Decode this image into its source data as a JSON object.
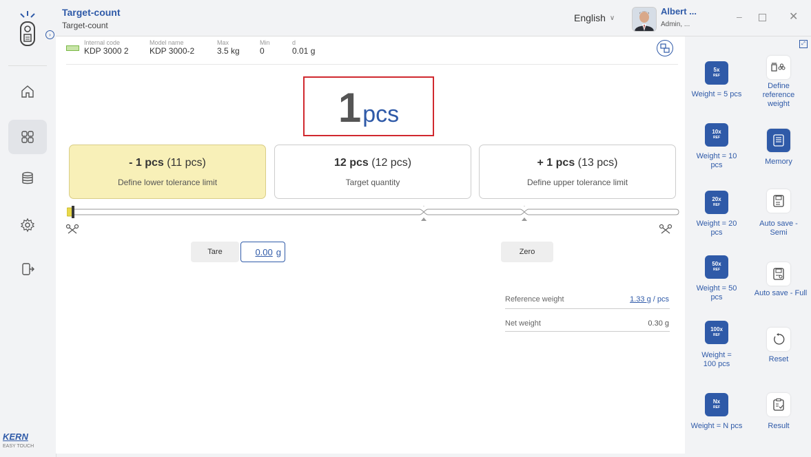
{
  "app": {
    "title": "Target-count",
    "subtitle": "Target-count",
    "language": "English",
    "user_name": "Albert ...",
    "user_role": "Admin, ...",
    "brand": "KERN",
    "brand_sub": "EASY TOUCH"
  },
  "device": {
    "internal_code_label": "Internal code",
    "internal_code": "KDP 3000 2",
    "model_name_label": "Model name",
    "model_name": "KDP 3000-2",
    "max_label": "Max",
    "max": "3.5 kg",
    "min_label": "Min",
    "min": "0",
    "d_label": "d",
    "d": "0.01 g"
  },
  "display": {
    "value": "1",
    "unit": "pcs"
  },
  "tolerance": {
    "lower": {
      "main": "- 1 pcs",
      "sub": "(11 pcs)",
      "label": "Define lower tolerance limit"
    },
    "target": {
      "main": "12 pcs",
      "sub": "(12 pcs)",
      "label": "Target quantity"
    },
    "upper": {
      "main": "+ 1 pcs",
      "sub": "(13 pcs)",
      "label": "Define upper tolerance limit"
    }
  },
  "controls": {
    "tare_label": "Tare",
    "tare_value": "0.00",
    "tare_unit": "g",
    "zero_label": "Zero"
  },
  "readouts": {
    "ref_weight_label": "Reference weight",
    "ref_weight_value": "1.33 g",
    "ref_weight_suffix": " / pcs",
    "net_weight_label": "Net weight",
    "net_weight_value": "0.30 g"
  },
  "right_panel": {
    "ref_tiles": [
      {
        "big": "5x",
        "small": "REF",
        "label": "Weight = 5 pcs"
      },
      {
        "big": "10x",
        "small": "REF",
        "label": "Weight = 10 pcs"
      },
      {
        "big": "20x",
        "small": "REF",
        "label": "Weight = 20 pcs"
      },
      {
        "big": "50x",
        "small": "REF",
        "label": "Weight = 50 pcs"
      },
      {
        "big": "100x",
        "small": "REF",
        "label": "Weight = 100 pcs"
      },
      {
        "big": "Nx",
        "small": "REF",
        "label": "Weight = N pcs"
      }
    ],
    "actions": [
      {
        "label": "Define reference weight",
        "icon": "define-reference-icon"
      },
      {
        "label": "Memory",
        "icon": "memory-icon"
      },
      {
        "label": "Auto save - Semi",
        "icon": "auto-save-semi-icon"
      },
      {
        "label": "Auto save - Full",
        "icon": "auto-save-full-icon"
      },
      {
        "label": "Reset",
        "icon": "reset-icon"
      },
      {
        "label": "Result",
        "icon": "result-icon"
      }
    ]
  },
  "colors": {
    "accent": "#2f5aa8",
    "highlight_red": "#d0282e",
    "active_card": "#f8f0b8",
    "slider_marker": "#e8d84a"
  }
}
